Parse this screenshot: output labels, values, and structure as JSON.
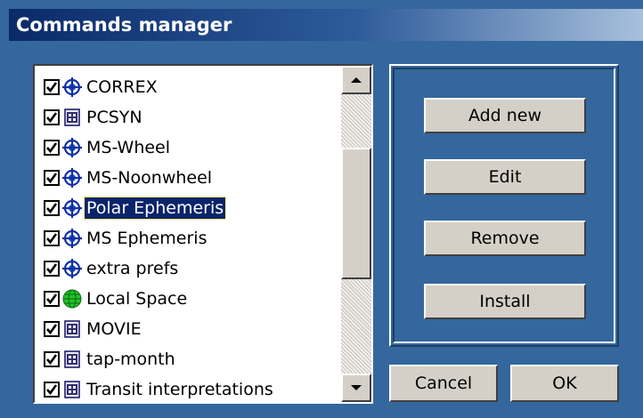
{
  "window": {
    "title": "Commands manager"
  },
  "commands": [
    {
      "label": "CORREX",
      "checked": true,
      "icon": "crosshair-globe-icon"
    },
    {
      "label": "PCSYN",
      "checked": true,
      "icon": "film-document-icon"
    },
    {
      "label": "MS-Wheel",
      "checked": true,
      "icon": "crosshair-globe-icon"
    },
    {
      "label": "MS-Noonwheel",
      "checked": true,
      "icon": "crosshair-globe-icon"
    },
    {
      "label": "Polar Ephemeris",
      "checked": true,
      "icon": "crosshair-globe-icon",
      "selected": true
    },
    {
      "label": "MS Ephemeris",
      "checked": true,
      "icon": "crosshair-globe-icon"
    },
    {
      "label": "extra prefs",
      "checked": true,
      "icon": "crosshair-globe-icon"
    },
    {
      "label": "Local Space",
      "checked": true,
      "icon": "green-globe-icon"
    },
    {
      "label": "MOVIE",
      "checked": true,
      "icon": "film-document-icon"
    },
    {
      "label": "tap-month",
      "checked": true,
      "icon": "film-document-icon"
    },
    {
      "label": "Transit interpretations",
      "checked": true,
      "icon": "film-document-icon"
    }
  ],
  "buttons": {
    "add_new": "Add new",
    "edit": "Edit",
    "remove": "Remove",
    "install": "Install",
    "cancel": "Cancel",
    "ok": "OK"
  },
  "colors": {
    "background": "#34679d",
    "selection": "#0a246a",
    "button_face": "#d4d0c8"
  }
}
